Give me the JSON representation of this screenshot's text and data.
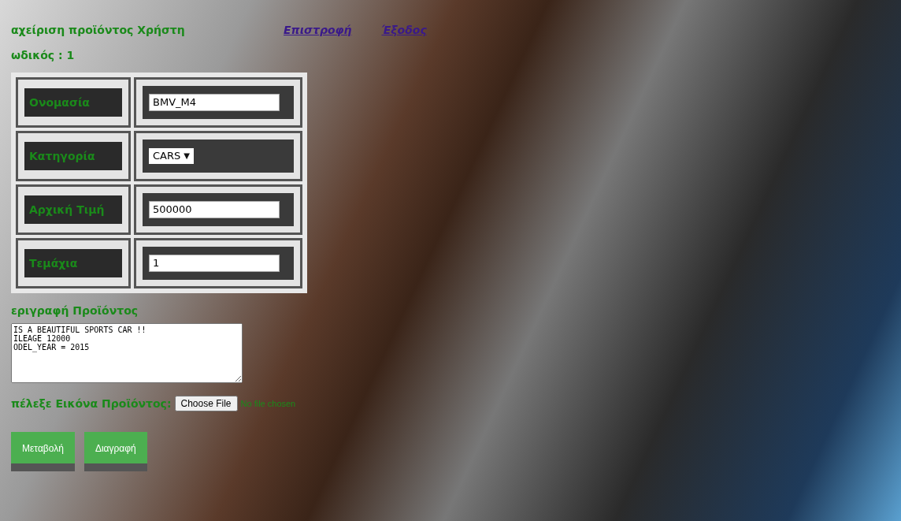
{
  "header": {
    "title": "αχείριση προϊόντος Χρήστη",
    "links": [
      "Επιστροφή",
      "Έξοδος"
    ],
    "code": "ωδικός : 1"
  },
  "form": {
    "rows": [
      {
        "label": "Ονομασία",
        "kind": "text",
        "value": "BMV_M4"
      },
      {
        "label": "Κατηγορία",
        "kind": "select",
        "value": "CARS",
        "caret": "▼"
      },
      {
        "label": "Αρχική Τιμή",
        "kind": "text",
        "value": "500000"
      },
      {
        "label": "Τεμάχια",
        "kind": "text",
        "value": "1"
      }
    ]
  },
  "description": {
    "label": "εριγραφή Προϊόντος",
    "value": "IS A BEAUTIFUL SPORTS CAR !!\nILEAGE 12000\nODEL_YEAR = 2015"
  },
  "image": {
    "label": "πέλεξε Εικόνα Προϊόντος:",
    "button": "Choose File",
    "status": "No file chosen"
  },
  "buttons": [
    "Μεταβολή",
    "Διαγραφή"
  ]
}
